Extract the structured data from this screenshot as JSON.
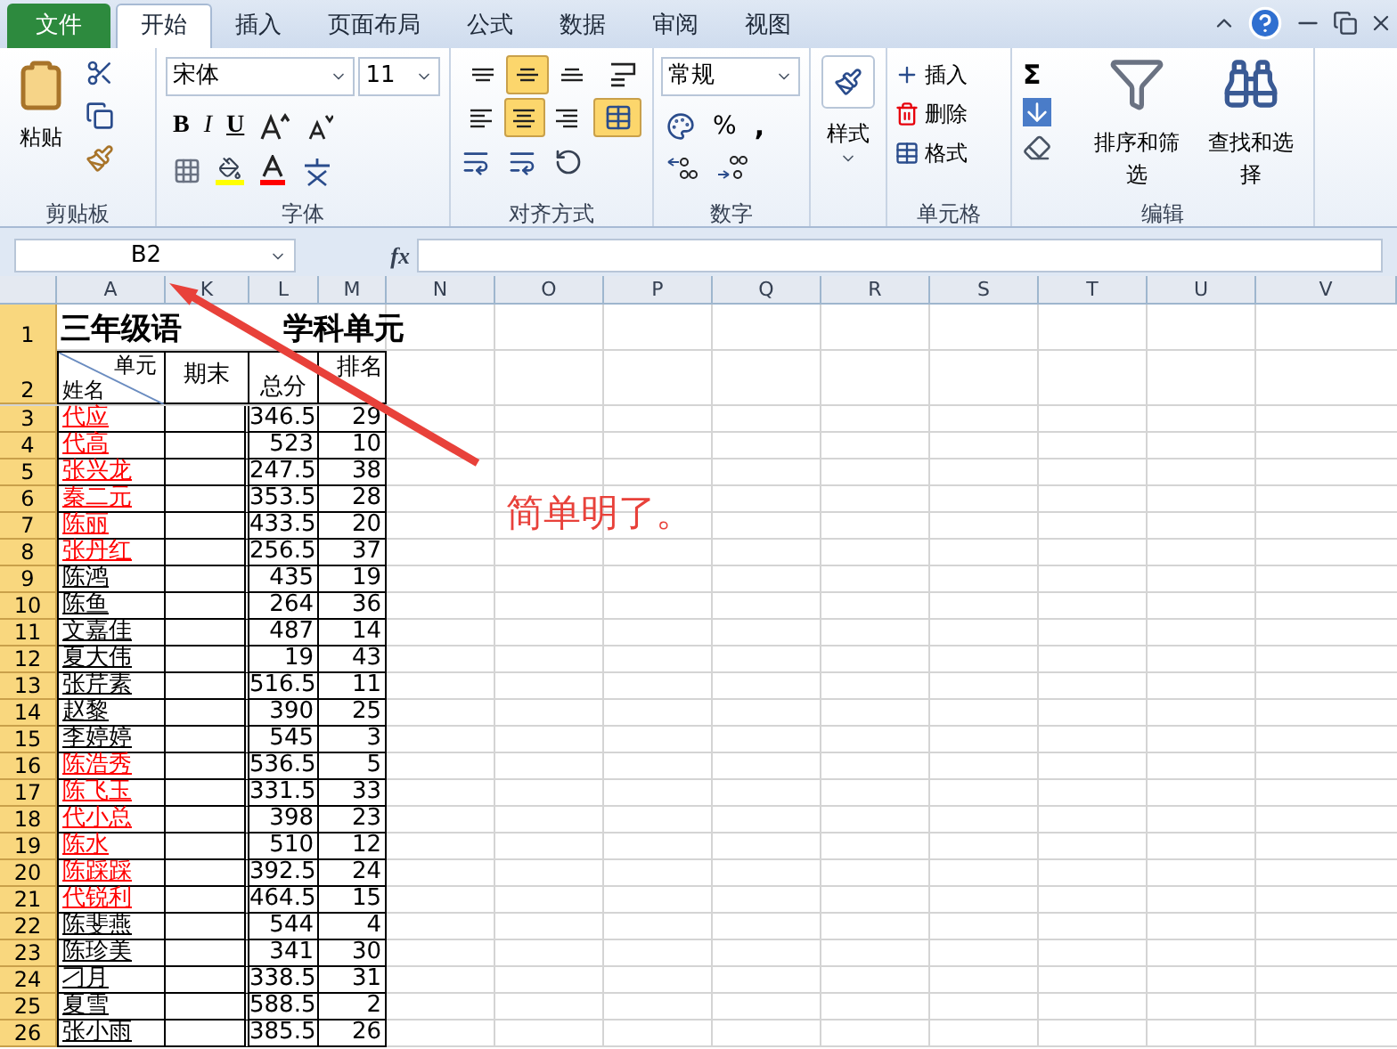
{
  "tabs": [
    {
      "label": "文件",
      "kind": "file",
      "selected": false
    },
    {
      "label": "开始",
      "kind": "tab",
      "selected": true
    },
    {
      "label": "插入",
      "kind": "tab",
      "selected": false
    },
    {
      "label": "页面布局",
      "kind": "tab",
      "selected": false
    },
    {
      "label": "公式",
      "kind": "tab",
      "selected": false
    },
    {
      "label": "数据",
      "kind": "tab",
      "selected": false
    },
    {
      "label": "审阅",
      "kind": "tab",
      "selected": false
    },
    {
      "label": "视图",
      "kind": "tab",
      "selected": false
    }
  ],
  "clipboard": {
    "paste": "粘贴",
    "label": "剪贴板"
  },
  "font": {
    "family": "宋体",
    "size": "11",
    "bold": "B",
    "italic": "I",
    "underline": "U",
    "label": "字体"
  },
  "alignment": {
    "buttons": [
      {
        "kind": "top",
        "on": false
      },
      {
        "kind": "middle",
        "on": true
      },
      {
        "kind": "bottom",
        "on": false
      },
      {
        "kind": "left",
        "on": false
      },
      {
        "kind": "center",
        "on": true
      },
      {
        "kind": "right",
        "on": false
      }
    ],
    "merge_on": true,
    "label": "对齐方式"
  },
  "number": {
    "format": "常规",
    "percent": "%",
    "comma": ",",
    "label": "数字"
  },
  "styles": {
    "button": "样式"
  },
  "cells": {
    "items": [
      "插入",
      "删除",
      "格式"
    ],
    "label": "单元格"
  },
  "editing": {
    "sigma": "Σ",
    "sort": "排序和筛选",
    "find": "查找和选择",
    "label": "编辑"
  },
  "formula_bar": {
    "name_box": "B2",
    "fx": "fx"
  },
  "sheet": {
    "columns": [
      "A",
      "K",
      "L",
      "M",
      "N",
      "O",
      "P",
      "Q",
      "R",
      "S",
      "T",
      "U",
      "V"
    ],
    "title_row": "1",
    "title_parts": [
      "三年级语",
      "学科单元"
    ],
    "header_row": "2",
    "unit": "单元",
    "name": "姓名",
    "col_k": "期末",
    "col_l": "总分",
    "col_m": "排名",
    "rows": [
      {
        "num": "3",
        "name": "代应",
        "color": "#ff0000",
        "total": "346.5",
        "rank": "29"
      },
      {
        "num": "4",
        "name": "代高",
        "color": "#ff0000",
        "total": "523",
        "rank": "10"
      },
      {
        "num": "5",
        "name": "张兴龙",
        "color": "#ff0000",
        "total": "247.5",
        "rank": "38"
      },
      {
        "num": "6",
        "name": "秦二元",
        "color": "#ff0000",
        "total": "353.5",
        "rank": "28"
      },
      {
        "num": "7",
        "name": "陈丽",
        "color": "#ff0000",
        "total": "433.5",
        "rank": "20"
      },
      {
        "num": "8",
        "name": "张丹红",
        "color": "#ff0000",
        "total": "256.5",
        "rank": "37"
      },
      {
        "num": "9",
        "name": "陈鸿",
        "color": "#000000",
        "total": "435",
        "rank": "19"
      },
      {
        "num": "10",
        "name": "陈鱼",
        "color": "#000000",
        "total": "264",
        "rank": "36"
      },
      {
        "num": "11",
        "name": "文嘉佳",
        "color": "#000000",
        "total": "487",
        "rank": "14"
      },
      {
        "num": "12",
        "name": "夏大伟",
        "color": "#000000",
        "total": "19",
        "rank": "43"
      },
      {
        "num": "13",
        "name": "张芹素",
        "color": "#000000",
        "total": "516.5",
        "rank": "11"
      },
      {
        "num": "14",
        "name": "赵黎",
        "color": "#000000",
        "total": "390",
        "rank": "25"
      },
      {
        "num": "15",
        "name": "李婷婷",
        "color": "#000000",
        "total": "545",
        "rank": "3"
      },
      {
        "num": "16",
        "name": "陈浩秀",
        "color": "#ff0000",
        "total": "536.5",
        "rank": "5"
      },
      {
        "num": "17",
        "name": "陈飞玉",
        "color": "#ff0000",
        "total": "331.5",
        "rank": "33"
      },
      {
        "num": "18",
        "name": "代小总",
        "color": "#ff0000",
        "total": "398",
        "rank": "23"
      },
      {
        "num": "19",
        "name": "陈水",
        "color": "#ff0000",
        "total": "510",
        "rank": "12"
      },
      {
        "num": "20",
        "name": "陈踩踩",
        "color": "#ff0000",
        "total": "392.5",
        "rank": "24"
      },
      {
        "num": "21",
        "name": "代锐利",
        "color": "#ff0000",
        "total": "464.5",
        "rank": "15"
      },
      {
        "num": "22",
        "name": "陈斐燕",
        "color": "#000000",
        "total": "544",
        "rank": "4"
      },
      {
        "num": "23",
        "name": "陈珍美",
        "color": "#000000",
        "total": "341",
        "rank": "30"
      },
      {
        "num": "24",
        "name": "刁月",
        "color": "#000000",
        "total": "338.5",
        "rank": "31"
      },
      {
        "num": "25",
        "name": "夏雪",
        "color": "#000000",
        "total": "588.5",
        "rank": "2"
      },
      {
        "num": "26",
        "name": "张小雨",
        "color": "#000000",
        "total": "385.5",
        "rank": "26"
      }
    ]
  },
  "annotation": {
    "text": "简单明了。"
  }
}
